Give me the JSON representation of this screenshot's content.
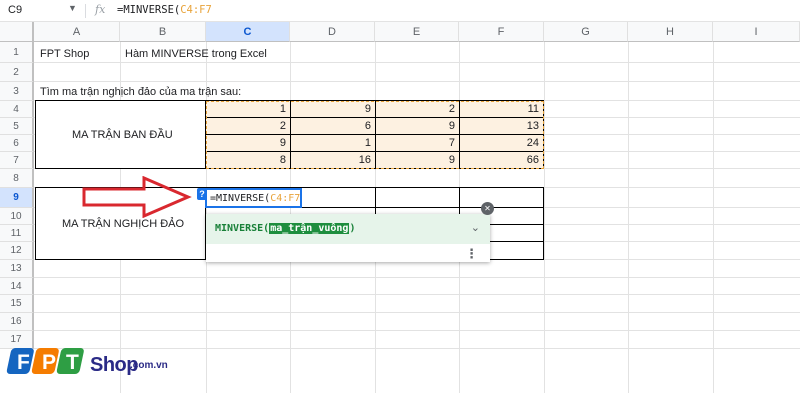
{
  "formula_bar": {
    "name_box": "C9",
    "name_dropdown_icon": "chevron-down-icon",
    "fx_icon": "fx",
    "formula_prefix": "=MINVERSE(",
    "formula_ref": "C4:F7"
  },
  "columns": [
    "A",
    "B",
    "C",
    "D",
    "E",
    "F",
    "G",
    "H",
    "I"
  ],
  "rows": [
    "1",
    "2",
    "3",
    "4",
    "5",
    "6",
    "7",
    "8",
    "9",
    "10",
    "11",
    "12",
    "13",
    "14",
    "15",
    "16",
    "17"
  ],
  "cells": {
    "a1": "FPT Shop",
    "b1": "Hàm MINVERSE trong Excel",
    "a3": "Tìm ma trận nghịch đảo của ma trận sau:",
    "original_label": "MA TRẬN BAN ĐẦU",
    "inverse_label": "MA TRẬN NGHỊCH ĐẢO"
  },
  "matrix": [
    [
      "1",
      "9",
      "2",
      "11"
    ],
    [
      "2",
      "6",
      "9",
      "13"
    ],
    [
      "9",
      "1",
      "7",
      "24"
    ],
    [
      "8",
      "16",
      "9",
      "66"
    ]
  ],
  "editor": {
    "help_badge": "?",
    "formula_prefix": "=MINVERSE(",
    "formula_ref": "C4:F7"
  },
  "autocomplete": {
    "function_name": "MINVERSE(",
    "argument": "ma_trận_vuông",
    "closing": ")",
    "expand_icon": "chevron-down-icon",
    "more_icon": "more-vert-icon",
    "close_icon": "close-icon"
  },
  "logo": {
    "shop": "Shop",
    "domain": ".com.vn"
  },
  "colors": {
    "accent": "#1a73e8",
    "selected_header": "#d3e3fd",
    "range_highlight": "#fdf1e1",
    "range_border": "#e8a33a",
    "popup_green": "#188038",
    "arrow_red": "#d9282f"
  }
}
